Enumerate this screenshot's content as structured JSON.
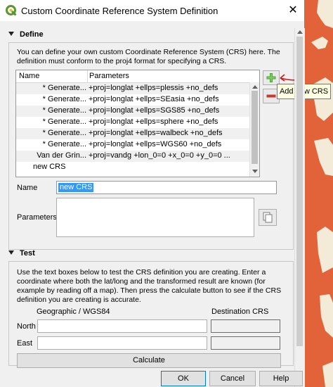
{
  "window": {
    "title": "Custom Coordinate Reference System Definition",
    "close_glyph": "✕"
  },
  "define": {
    "header": "Define",
    "description_line1": "You can define your own custom Coordinate Reference System (CRS) here. The",
    "description_line2": "definition must conform to the proj4 format for specifying a CRS.",
    "table": {
      "columns": [
        "Name",
        "Parameters"
      ],
      "rows": [
        {
          "name": "* Generate...",
          "params": "+proj=longlat +ellps=plessis +no_defs"
        },
        {
          "name": "* Generate...",
          "params": "+proj=longlat +ellps=SEasia +no_defs"
        },
        {
          "name": "* Generate...",
          "params": "+proj=longlat +ellps=SGS85 +no_defs"
        },
        {
          "name": "* Generate...",
          "params": "+proj=longlat +ellps=sphere +no_defs"
        },
        {
          "name": "* Generate...",
          "params": "+proj=longlat +ellps=walbeck +no_defs"
        },
        {
          "name": "* Generate...",
          "params": "+proj=longlat +ellps=WGS60 +no_defs"
        },
        {
          "name": "Van der Grin...",
          "params": "+proj=vandg +lon_0=0 +x_0=0 +y_0=0 ..."
        },
        {
          "name": "new CRS",
          "params": ""
        }
      ]
    },
    "tooltip": "Add new CRS",
    "name_label": "Name",
    "name_value": "new CRS",
    "parameters_label": "Parameters",
    "parameters_value": ""
  },
  "test": {
    "header": "Test",
    "description": [
      "Use the text boxes below to test the CRS definition you are creating. Enter a",
      "coordinate where both the lat/long and the transformed result are known (for",
      "example by reading off a map). Then press the calculate button to see if the CRS",
      "definition you are creating is accurate."
    ],
    "geographic_label": "Geographic / WGS84",
    "destination_label": "Destination CRS",
    "north_label": "North",
    "east_label": "East",
    "calculate_label": "Calculate"
  },
  "buttons": {
    "ok": "OK",
    "cancel": "Cancel",
    "help": "Help"
  },
  "colors": {
    "map_fill": "#e2633a",
    "map_land": "#f3ead7",
    "annotation": "#d01818"
  }
}
